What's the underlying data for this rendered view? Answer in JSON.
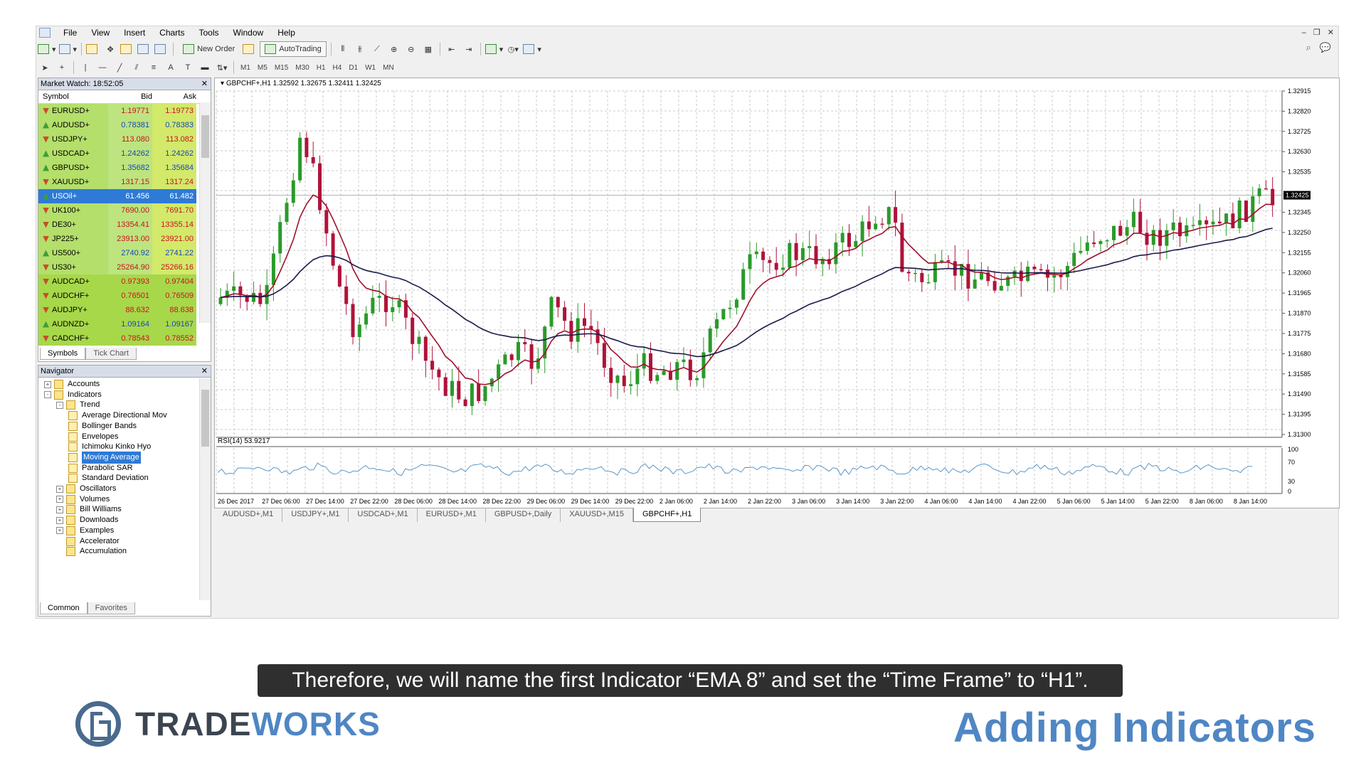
{
  "menu": [
    "File",
    "View",
    "Insert",
    "Charts",
    "Tools",
    "Window",
    "Help"
  ],
  "toolbar": {
    "new_order": "New Order",
    "autotrading": "AutoTrading",
    "timeframes": [
      "M1",
      "M5",
      "M15",
      "M30",
      "H1",
      "H4",
      "D1",
      "W1",
      "MN"
    ]
  },
  "market_watch": {
    "title": "Market Watch: 18:52:05",
    "columns": [
      "Symbol",
      "Bid",
      "Ask"
    ],
    "rows": [
      {
        "symbol": "EURUSD+",
        "bid": "1.19771",
        "ask": "1.19773",
        "dir": "dn"
      },
      {
        "symbol": "AUDUSD+",
        "bid": "0.78381",
        "ask": "0.78383",
        "dir": "up"
      },
      {
        "symbol": "USDJPY+",
        "bid": "113.080",
        "ask": "113.082",
        "dir": "dn"
      },
      {
        "symbol": "USDCAD+",
        "bid": "1.24262",
        "ask": "1.24262",
        "dir": "up"
      },
      {
        "symbol": "GBPUSD+",
        "bid": "1.35682",
        "ask": "1.35684",
        "dir": "up"
      },
      {
        "symbol": "XAUUSD+",
        "bid": "1317.15",
        "ask": "1317.24",
        "dir": "dn"
      },
      {
        "symbol": "USOil+",
        "bid": "61.456",
        "ask": "61.482",
        "dir": "up"
      },
      {
        "symbol": "UK100+",
        "bid": "7690.00",
        "ask": "7691.70",
        "dir": "dn"
      },
      {
        "symbol": "DE30+",
        "bid": "13354.41",
        "ask": "13355.14",
        "dir": "dn"
      },
      {
        "symbol": "JP225+",
        "bid": "23913.00",
        "ask": "23921.00",
        "dir": "dn"
      },
      {
        "symbol": "US500+",
        "bid": "2740.92",
        "ask": "2741.22",
        "dir": "up"
      },
      {
        "symbol": "US30+",
        "bid": "25264.90",
        "ask": "25266.16",
        "dir": "dn"
      },
      {
        "symbol": "AUDCAD+",
        "bid": "0.97393",
        "ask": "0.97404",
        "dir": "dn"
      },
      {
        "symbol": "AUDCHF+",
        "bid": "0.76501",
        "ask": "0.76509",
        "dir": "dn"
      },
      {
        "symbol": "AUDJPY+",
        "bid": "88.632",
        "ask": "88.638",
        "dir": "dn"
      },
      {
        "symbol": "AUDNZD+",
        "bid": "1.09164",
        "ask": "1.09167",
        "dir": "up"
      },
      {
        "symbol": "CADCHF+",
        "bid": "0.78543",
        "ask": "0.78552",
        "dir": "dn"
      }
    ],
    "tabs": [
      "Symbols",
      "Tick Chart"
    ]
  },
  "navigator": {
    "title": "Navigator",
    "items": [
      {
        "label": "Accounts",
        "level": 0,
        "exp": "+"
      },
      {
        "label": "Indicators",
        "level": 0,
        "exp": "-"
      },
      {
        "label": "Trend",
        "level": 1,
        "exp": "-"
      },
      {
        "label": "Average Directional Mov",
        "level": 2
      },
      {
        "label": "Bollinger Bands",
        "level": 2
      },
      {
        "label": "Envelopes",
        "level": 2
      },
      {
        "label": "Ichimoku Kinko Hyo",
        "level": 2
      },
      {
        "label": "Moving Average",
        "level": 2,
        "selected": true
      },
      {
        "label": "Parabolic SAR",
        "level": 2
      },
      {
        "label": "Standard Deviation",
        "level": 2
      },
      {
        "label": "Oscillators",
        "level": 1,
        "exp": "+"
      },
      {
        "label": "Volumes",
        "level": 1,
        "exp": "+"
      },
      {
        "label": "Bill Williams",
        "level": 1,
        "exp": "+"
      },
      {
        "label": "Downloads",
        "level": 1,
        "exp": "+"
      },
      {
        "label": "Examples",
        "level": 1,
        "exp": "+"
      },
      {
        "label": "Accelerator",
        "level": 1
      },
      {
        "label": "Accumulation",
        "level": 1
      }
    ],
    "tabs": [
      "Common",
      "Favorites"
    ]
  },
  "chart": {
    "symbol_line": "GBPCHF+,H1  1.32592 1.32675 1.32411 1.32425",
    "rsi_label": "RSI(14) 53.9217",
    "current_price": "1.32425",
    "price_ticks": [
      "1.32915",
      "1.32820",
      "1.32725",
      "1.32630",
      "1.32535",
      "1.32345",
      "1.32250",
      "1.32155",
      "1.32060",
      "1.31965",
      "1.31870",
      "1.31775",
      "1.31680",
      "1.31585",
      "1.31490",
      "1.31395",
      "1.31300"
    ],
    "rsi_ticks": [
      "100",
      "70",
      "30",
      "0"
    ],
    "time_ticks": [
      "26 Dec 2017",
      "27 Dec 06:00",
      "27 Dec 14:00",
      "27 Dec 22:00",
      "28 Dec 06:00",
      "28 Dec 14:00",
      "28 Dec 22:00",
      "29 Dec 06:00",
      "29 Dec 14:00",
      "29 Dec 22:00",
      "2 Jan 06:00",
      "2 Jan 14:00",
      "2 Jan 22:00",
      "3 Jan 06:00",
      "3 Jan 14:00",
      "3 Jan 22:00",
      "4 Jan 06:00",
      "4 Jan 14:00",
      "4 Jan 22:00",
      "5 Jan 06:00",
      "5 Jan 14:00",
      "5 Jan 22:00",
      "8 Jan 06:00",
      "8 Jan 14:00"
    ],
    "tabs": [
      "AUDUSD+,M1",
      "USDJPY+,M1",
      "USDCAD+,M1",
      "EURUSD+,M1",
      "GBPUSD+,Daily",
      "XAUUSD+,M15",
      "GBPCHF+,H1"
    ],
    "colors": {
      "bull": "#2a9a2a",
      "bear": "#b0123a",
      "ema": "#a0102c",
      "ma": "#1a1a4a",
      "rsi": "#5a96c8",
      "grid": "#c8c8c8"
    }
  },
  "caption": "Therefore, we will name the first Indicator “EMA 8” and set the “Time Frame” to “H1”.",
  "brand": {
    "part1": "TRADE",
    "part2": "WORKS"
  },
  "title": "Adding Indicators"
}
